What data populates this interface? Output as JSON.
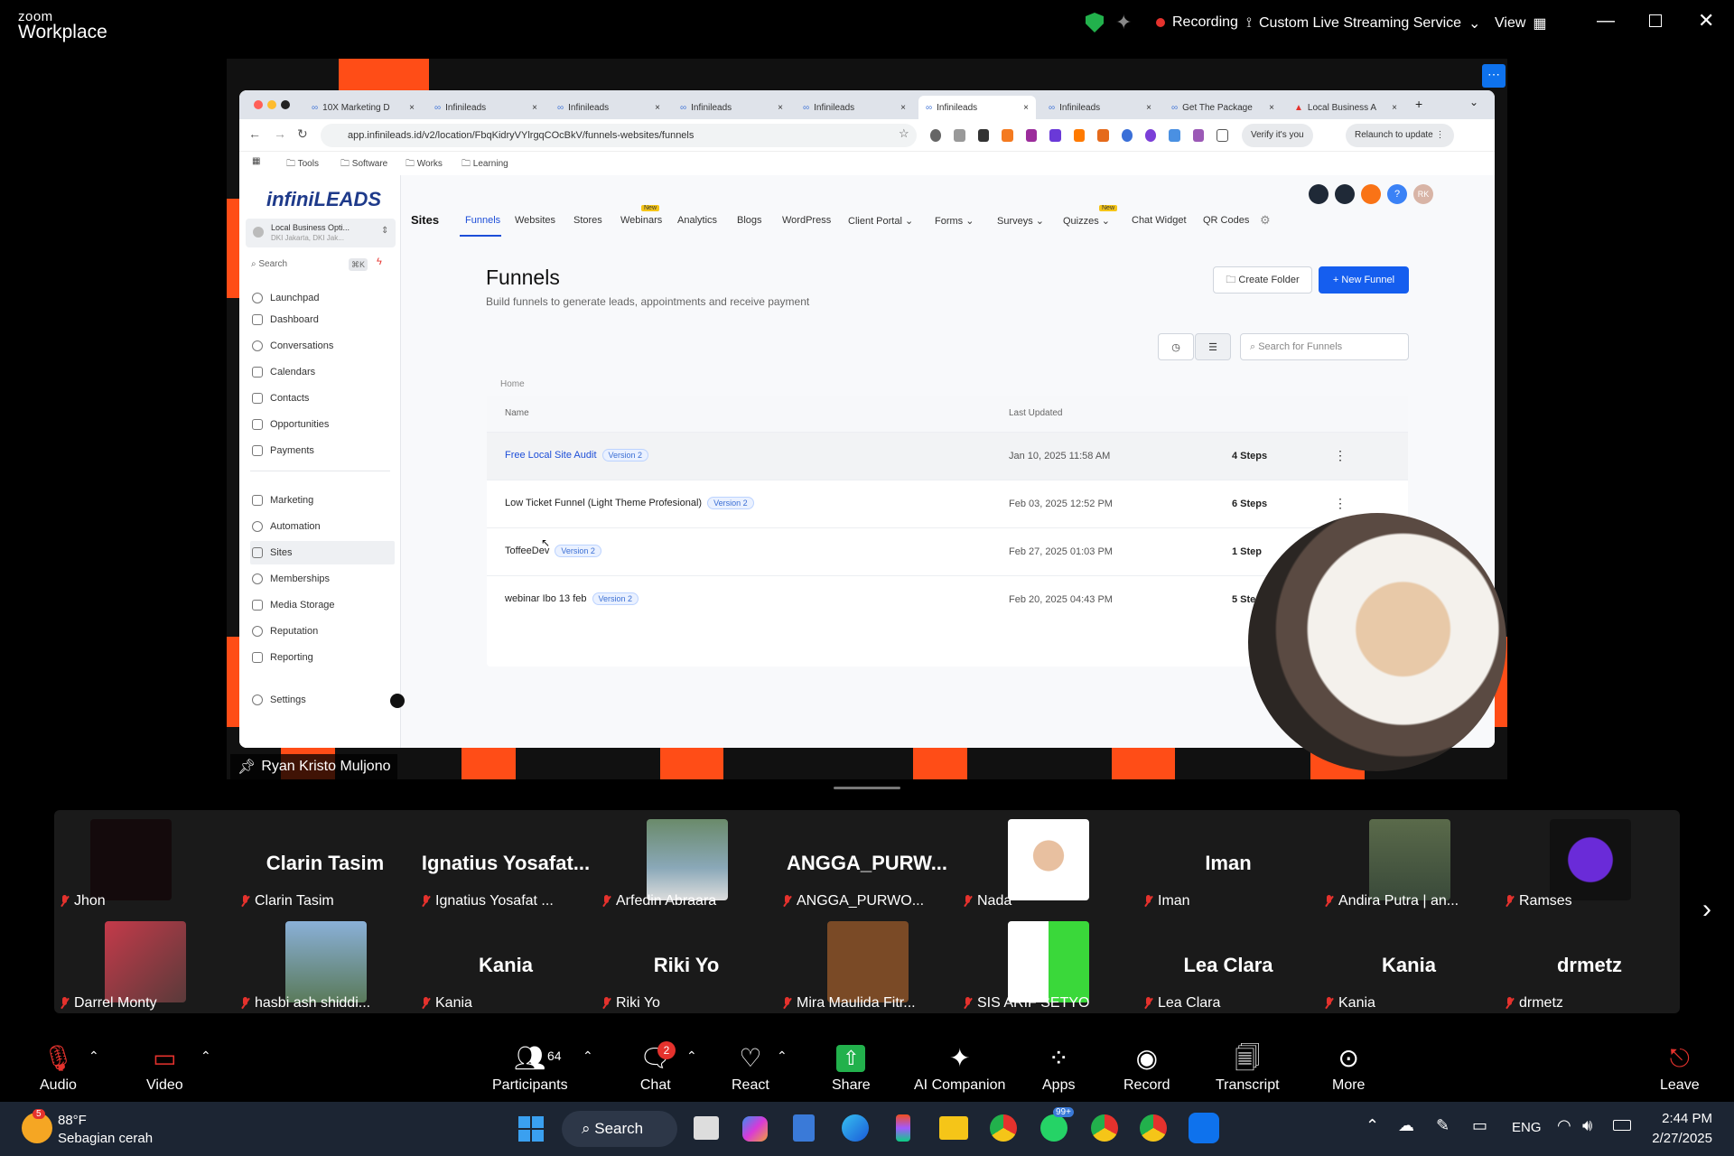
{
  "zoom": {
    "brand_small": "zoom",
    "brand_big": "Workplace",
    "recording": "Recording",
    "streaming": "Custom Live Streaming Service",
    "view": "View"
  },
  "browser": {
    "tabs": [
      "10X Marketing D",
      "Infinileads",
      "Infinileads",
      "Infinileads",
      "Infinileads",
      "Infinileads",
      "Infinileads",
      "Get The Package",
      "Local Business A"
    ],
    "url": "app.infinileads.id/v2/location/FbqKidryVYlrgqCOcBkV/funnels-websites/funnels",
    "verify": "Verify it's you",
    "relaunch": "Relaunch to update",
    "bookmarks": [
      "Tools",
      "Software",
      "Works",
      "Learning"
    ]
  },
  "app": {
    "logo": "infiniLEADS",
    "location_name": "Local Business Opti...",
    "location_sub": "DKI Jakarta, DKI Jak...",
    "search": "Search",
    "search_kbd": "⌘K",
    "nav": [
      "Launchpad",
      "Dashboard",
      "Conversations",
      "Calendars",
      "Contacts",
      "Opportunities",
      "Payments",
      "Marketing",
      "Automation",
      "Sites",
      "Memberships",
      "Media Storage",
      "Reputation",
      "Reporting",
      "Settings"
    ],
    "topnav": {
      "sites": "Sites",
      "items": [
        "Funnels",
        "Websites",
        "Stores",
        "Webinars",
        "Analytics",
        "Blogs",
        "WordPress",
        "Client Portal",
        "Forms",
        "Surveys",
        "Quizzes",
        "Chat Widget",
        "QR Codes"
      ],
      "new": "New"
    },
    "avatar_initials": "RK",
    "page_title": "Funnels",
    "page_subtitle": "Build funnels to generate leads, appointments and receive payment",
    "create_folder": "Create Folder",
    "new_funnel": "+ New Funnel",
    "search_funnels": "Search for Funnels",
    "breadcrumb": "Home",
    "col_name": "Name",
    "col_updated": "Last Updated",
    "rows": [
      {
        "name": "Free Local Site Audit",
        "version": "Version 2",
        "updated": "Jan 10, 2025 11:58 AM",
        "steps": "4 Steps"
      },
      {
        "name": "Low Ticket Funnel (Light Theme Profesional)",
        "version": "Version 2",
        "updated": "Feb 03, 2025 12:52 PM",
        "steps": "6 Steps"
      },
      {
        "name": "ToffeeDev",
        "version": "Version 2",
        "updated": "Feb 27, 2025 01:03 PM",
        "steps": "1 Step"
      },
      {
        "name": "webinar Ibo 13 feb",
        "version": "Version 2",
        "updated": "Feb 20, 2025 04:43 PM",
        "steps": "5 Ste"
      }
    ]
  },
  "presenter": "Ryan Kristo Muljono",
  "gallery": [
    {
      "big": "",
      "label": "Jhon"
    },
    {
      "big": "Clarin Tasim",
      "label": "Clarin Tasim"
    },
    {
      "big": "Ignatius  Yosafat...",
      "label": "Ignatius Yosafat ..."
    },
    {
      "big": "",
      "label": "Arfedin Abraara"
    },
    {
      "big": "ANGGA_PURW...",
      "label": "ANGGA_PURWO..."
    },
    {
      "big": "",
      "label": "Nada"
    },
    {
      "big": "Iman",
      "label": "Iman"
    },
    {
      "big": "",
      "label": "Andira Putra | an..."
    },
    {
      "big": "",
      "label": "Ramses"
    },
    {
      "big": "",
      "label": "Darrel Monty"
    },
    {
      "big": "",
      "label": "hasbi ash shiddi..."
    },
    {
      "big": "Kania",
      "label": "Kania"
    },
    {
      "big": "Riki Yo",
      "label": "Riki Yo"
    },
    {
      "big": "",
      "label": "Mira Maulida Fitr..."
    },
    {
      "big": "",
      "label": "SIS ARIF SETYO"
    },
    {
      "big": "Lea Clara",
      "label": "Lea Clara"
    },
    {
      "big": "Kania",
      "label": "Kania"
    },
    {
      "big": "drmetz",
      "label": "drmetz"
    }
  ],
  "toolbar": {
    "audio": "Audio",
    "video": "Video",
    "participants": "Participants",
    "participants_count": "64",
    "chat": "Chat",
    "chat_badge": "2",
    "react": "React",
    "share": "Share",
    "ai": "AI Companion",
    "apps": "Apps",
    "record": "Record",
    "transcript": "Transcript",
    "more": "More",
    "leave": "Leave"
  },
  "taskbar": {
    "temp": "88°F",
    "weather": "Sebagian cerah",
    "weather_badge": "5",
    "search": "Search",
    "lang": "ENG",
    "time": "2:44 PM",
    "date": "2/27/2025",
    "badge_99": "99+"
  }
}
